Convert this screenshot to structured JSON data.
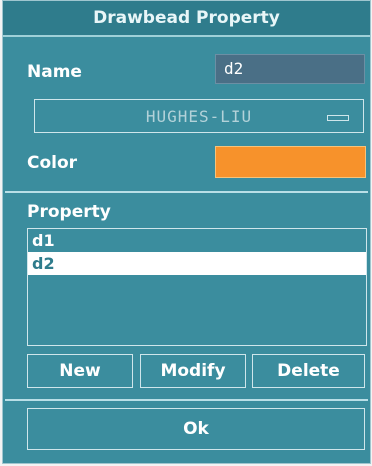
{
  "title": "Drawbead Property",
  "name": {
    "label": "Name",
    "value": "d2"
  },
  "material_select": {
    "value": "HUGHES-LIU"
  },
  "color": {
    "label": "Color",
    "value": "#f7922b"
  },
  "property": {
    "label": "Property",
    "items": [
      "d1",
      "d2"
    ],
    "selected": "d2"
  },
  "buttons": {
    "new": "New",
    "modify": "Modify",
    "delete": "Delete",
    "ok": "Ok"
  }
}
